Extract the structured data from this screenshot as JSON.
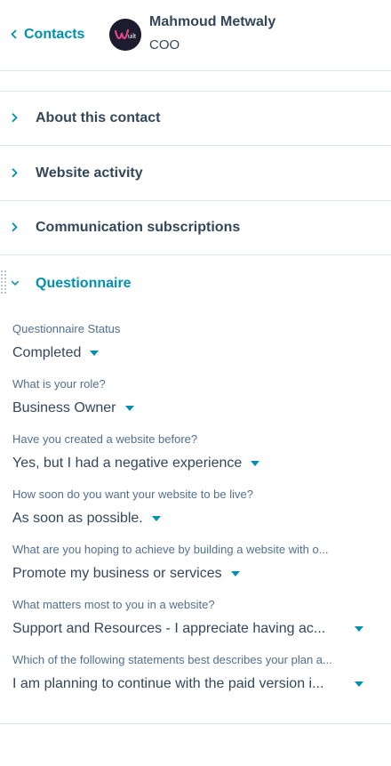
{
  "header": {
    "back_label": "Contacts",
    "name": "Mahmoud Metwaly",
    "job_title": "COO",
    "avatar_text": "Wuilt"
  },
  "sections": [
    {
      "label": "About this contact",
      "expanded": false
    },
    {
      "label": "Website activity",
      "expanded": false
    },
    {
      "label": "Communication subscriptions",
      "expanded": false
    },
    {
      "label": "Questionnaire",
      "expanded": true
    }
  ],
  "questionnaire": {
    "properties": [
      {
        "label": "Questionnaire Status",
        "value": "Completed"
      },
      {
        "label": "What is your role?",
        "value": "Business Owner"
      },
      {
        "label": "Have you created a website before?",
        "value": "Yes, but I had a negative experience"
      },
      {
        "label": "How soon do you want your website to be live?",
        "value": "As soon as possible."
      },
      {
        "label": "What are you hoping to achieve by building a website with o...",
        "value": "Promote my business or services"
      },
      {
        "label": "What matters most to you in a website?",
        "value": "Support and Resources - I appreciate having ac..."
      },
      {
        "label": "Which of the following statements best describes your plan a...",
        "value": "I am planning to continue with the paid version i..."
      }
    ]
  },
  "colors": {
    "accent": "#0091ae",
    "text": "#33475b",
    "label": "#516f90",
    "divider": "#dfe3eb"
  }
}
